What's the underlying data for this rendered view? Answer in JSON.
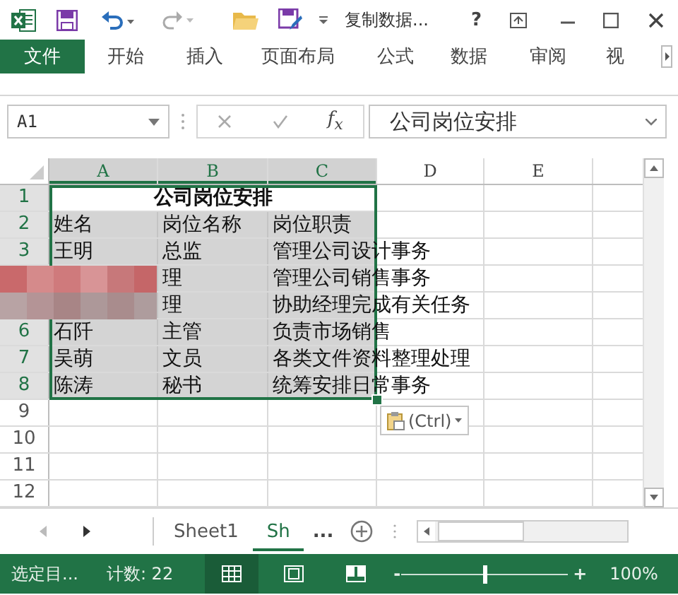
{
  "title_bar": {
    "title": "复制数据...",
    "help": "?"
  },
  "ribbon": {
    "tabs": [
      {
        "label": "文件",
        "selected": true
      },
      {
        "label": "开始",
        "selected": false
      },
      {
        "label": "插入",
        "selected": false
      },
      {
        "label": "页面布局",
        "selected": false
      },
      {
        "label": "公式",
        "selected": false
      },
      {
        "label": "数据",
        "selected": false
      },
      {
        "label": "审阅",
        "selected": false
      },
      {
        "label": "视",
        "selected": false
      }
    ]
  },
  "formula_bar": {
    "name_box": "A1",
    "function_label": "f$_{x}$",
    "formula": "公司岗位安排"
  },
  "sheet": {
    "columns": [
      {
        "label": "A",
        "selected": true
      },
      {
        "label": "B",
        "selected": true
      },
      {
        "label": "C",
        "selected": true
      },
      {
        "label": "D",
        "selected": false
      },
      {
        "label": "E",
        "selected": false
      }
    ],
    "rows": [
      {
        "number": "1",
        "selected": true,
        "kind": "title",
        "title": "公司岗位安排"
      },
      {
        "number": "2",
        "selected": true,
        "kind": "data",
        "A": "姓名",
        "B": "岗位名称",
        "C": "岗位职责"
      },
      {
        "number": "3",
        "selected": true,
        "kind": "data",
        "A": "王明",
        "B": "总监",
        "C": "管理公司设计事务"
      },
      {
        "selected": true,
        "kind": "data",
        "B": "理",
        "C": "管理公司销售事务"
      },
      {
        "selected": true,
        "kind": "data",
        "B": "理",
        "C": "协助经理完成有关任务"
      },
      {
        "number": "6",
        "selected": true,
        "kind": "data",
        "A": "石阡",
        "B": "主管",
        "C": "负责市场销售"
      },
      {
        "number": "7",
        "selected": true,
        "kind": "data",
        "A": "吴萌",
        "B": "文员",
        "C": "各类文件资料整理处理"
      },
      {
        "number": "8",
        "selected": true,
        "kind": "data",
        "A": "陈涛",
        "B": "秘书",
        "C": "统筹安排日常事务"
      },
      {
        "number": "9",
        "selected": false,
        "kind": "data"
      },
      {
        "number": "10",
        "selected": false,
        "kind": "data"
      },
      {
        "number": "11",
        "selected": false,
        "kind": "data"
      },
      {
        "number": "12",
        "selected": false,
        "kind": "data"
      }
    ],
    "paste_options": {
      "label": "(Ctrl)"
    }
  },
  "sheet_tabs": {
    "tabs": [
      {
        "label": "Sheet1",
        "selected": false
      },
      {
        "label": "Sh",
        "selected": true
      }
    ],
    "overflow": "..."
  },
  "status_bar": {
    "mode": "选定目...",
    "count": "计数: 22",
    "views": [
      {
        "kind": "normal",
        "selected": true
      },
      {
        "kind": "page_layout",
        "selected": false
      },
      {
        "kind": "page_break",
        "selected": false
      }
    ],
    "zoom": {
      "minus": "-",
      "plus": "+",
      "level": 0.5,
      "reading": "100%"
    }
  }
}
